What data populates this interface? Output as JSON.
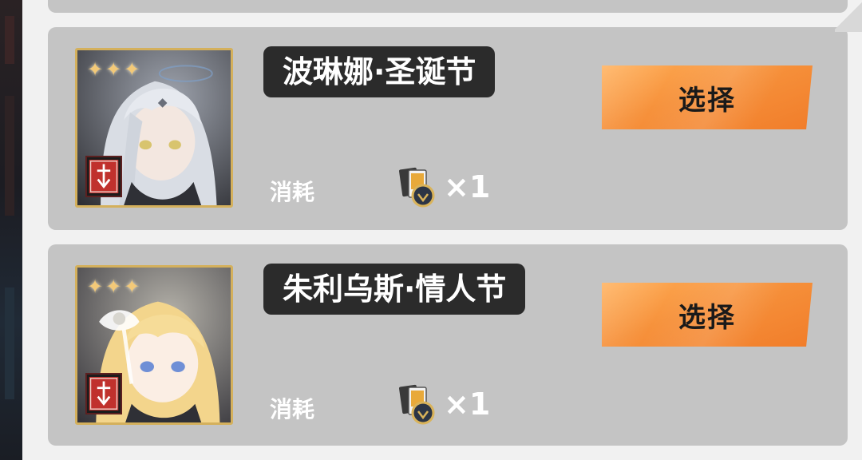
{
  "cards": [
    {
      "name": "波琳娜·圣诞节",
      "rarity_stars": "✦✦✦",
      "cost_label": "消耗",
      "cost_amount": "×1",
      "select_label": "选择",
      "portrait": "silver-haired-girl-portrait",
      "class_icon": "sword-class-icon",
      "cost_icon": "ticket-coin-icon"
    },
    {
      "name": "朱利乌斯·情人节",
      "rarity_stars": "✦✦✦",
      "cost_label": "消耗",
      "cost_amount": "×1",
      "select_label": "选择",
      "portrait": "blonde-girl-portrait",
      "class_icon": "sword-class-icon",
      "cost_icon": "ticket-coin-icon"
    }
  ],
  "colors": {
    "card_bg": "#c4c4c4",
    "name_plate_bg": "#2b2b2b",
    "button_orange": "#f6913b",
    "frame_gold": "#d4b05c",
    "star_gold": "#f3c978",
    "class_badge_red": "#c0312d"
  }
}
